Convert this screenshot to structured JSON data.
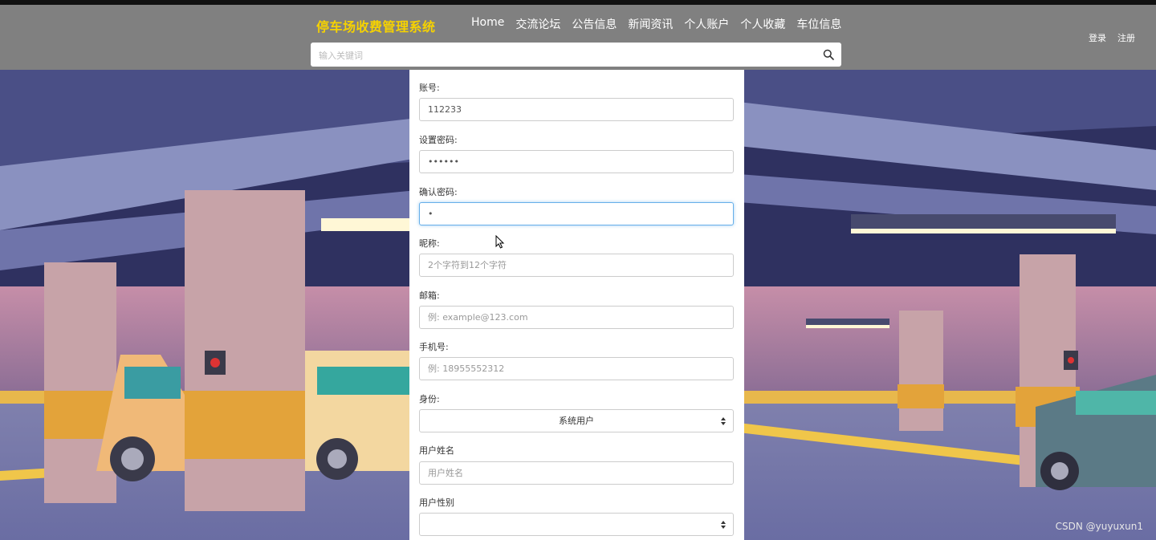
{
  "header": {
    "title": "停车场收费管理系统",
    "nav": [
      "Home",
      "交流论坛",
      "公告信息",
      "新闻资讯",
      "个人账户",
      "个人收藏",
      "车位信息"
    ],
    "login": "登录",
    "register": "注册",
    "search_placeholder": "输入关键词",
    "search_icon": "search-icon"
  },
  "form": {
    "account_label": "账号:",
    "account_value": "112233",
    "password_label": "设置密码:",
    "password_value": "••••••",
    "confirm_label": "确认密码:",
    "confirm_value": "•",
    "nickname_label": "昵称:",
    "nickname_placeholder": "2个字符到12个字符",
    "email_label": "邮箱:",
    "email_placeholder": "例: example@123.com",
    "phone_label": "手机号:",
    "phone_placeholder": "例: 18955552312",
    "role_label": "身份:",
    "role_value": "系统用户",
    "realname_label": "用户姓名",
    "realname_placeholder": "用户姓名",
    "gender_label": "用户性别",
    "gender_value": ""
  },
  "watermark": "CSDN @yuyuxun1",
  "colors": {
    "header_bg": "#808080",
    "title": "#f6d200",
    "focus": "#66afe9"
  }
}
